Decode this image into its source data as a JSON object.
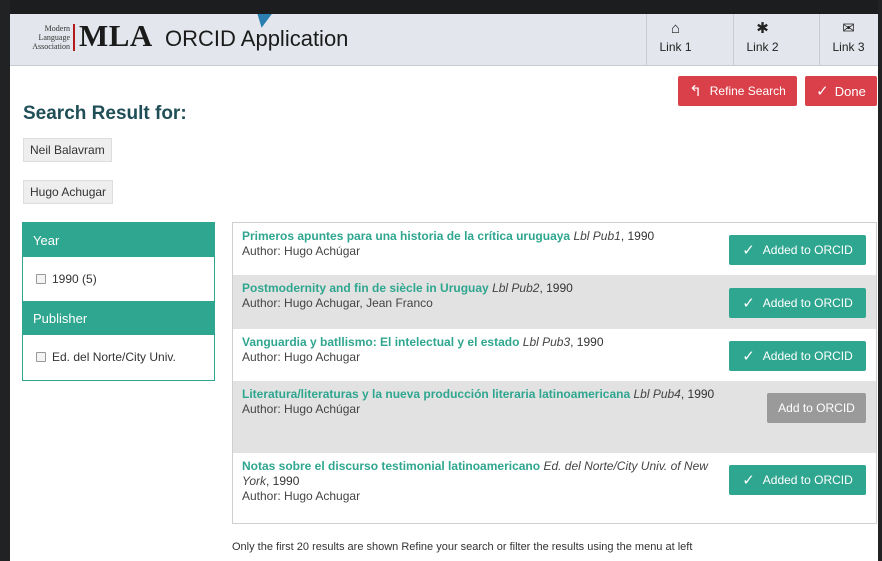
{
  "header": {
    "logo_small": [
      "Modern",
      "Language",
      "Association"
    ],
    "logo_text": "MLA",
    "app_title": "ORCID Application",
    "links": [
      {
        "label": "Link 1",
        "icon": "home-icon",
        "glyph": "⌂"
      },
      {
        "label": "Link 2",
        "icon": "gear-icon",
        "glyph": "✱"
      },
      {
        "label": "Link 3",
        "icon": "mail-icon",
        "glyph": "✉"
      }
    ]
  },
  "actions": {
    "refine_label": "Refine Search",
    "done_label": "Done"
  },
  "search": {
    "heading": "Search Result for:",
    "terms": [
      "Neil Balavram",
      "Hugo Achugar"
    ]
  },
  "filters": {
    "year_heading": "Year",
    "year_option": "1990 (5)",
    "publisher_heading": "Publisher",
    "publisher_option": "Ed. del Norte/City Univ."
  },
  "results": [
    {
      "title": "Primeros apuntes para una historia de la crítica uruguaya",
      "source": "Lbl Pub1",
      "year": ", 1990",
      "author": "Author: Hugo Achúgar",
      "button": "Added to ORCID",
      "added": true
    },
    {
      "title": "Postmodernity and fin de siècle in Uruguay",
      "source": "Lbl Pub2",
      "year": ", 1990",
      "author": "Author: Hugo Achugar, Jean Franco",
      "button": "Added to ORCID",
      "added": true
    },
    {
      "title": "Vanguardia y batllismo: El intelectual y el estado",
      "source": "Lbl Pub3",
      "year": ", 1990",
      "author": "Author: Hugo Achugar",
      "button": "Added to ORCID",
      "added": true
    },
    {
      "title": "Literatura/literaturas y la nueva producción literaria latinoamericana",
      "source": "Lbl Pub4",
      "year": ", 1990",
      "author": "Author: Hugo Achúgar",
      "button": "Add to ORCID",
      "added": false
    },
    {
      "title": "Notas sobre el discurso testimonial latinoamericano",
      "source": "Ed. del Norte/City Univ. of New York",
      "year": ", 1990",
      "author": "Author: Hugo Achugar",
      "button": "Added to ORCID",
      "added": true
    }
  ],
  "footer_note": "Only the first 20 results are shown Refine your search or filter the results using the menu at left",
  "colors": {
    "teal": "#2fa68f",
    "red": "#d9404a",
    "gray_button": "#9a9a9a"
  }
}
